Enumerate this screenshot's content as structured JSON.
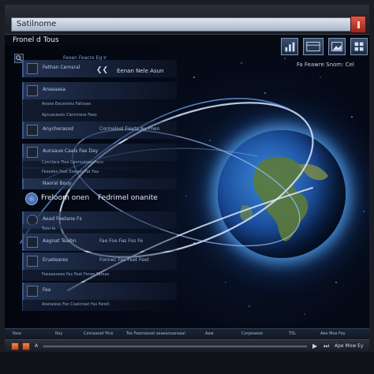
{
  "window": {
    "title_value": "Satilnome",
    "app_title": "Fronel d Tous"
  },
  "header": {
    "nav_link": "Eenan Nele Asun",
    "right_link": "Fa Feawre Snom: Cel"
  },
  "sidebar": {
    "search_text": "Feoen  Feacre  Eg  Ir",
    "items": [
      {
        "label": "Fethan Cernsral",
        "value": ""
      },
      {
        "label": "Anseaasa",
        "value": ""
      },
      {
        "label": "Anese Eecenlets  Fatisses",
        "value": ""
      },
      {
        "label": "Apcsacieels  Clennirere Fees",
        "value": ""
      },
      {
        "label": "Anycherasod",
        "value": "Cormeleel Fieets Au Fhen"
      },
      {
        "label": "Aunsaue Caals  Fae  Day",
        "value": ""
      },
      {
        "label": "Conclace Fiee  Caereatoen  Fens",
        "value": ""
      },
      {
        "label": "Feseden  Feat  Eeeeas  Fat  Fea",
        "value": ""
      },
      {
        "label": "Naoral  Bouy",
        "value": ""
      },
      {
        "label": "Aead  Feetane  Fs",
        "value": ""
      },
      {
        "label": "Tsou Ia",
        "value": ""
      },
      {
        "label": "Aagnat Teaibn",
        "value": "Fae  Foe  Fas  Fos  Fe"
      },
      {
        "label": "Erueleares",
        "value": "Fonnec  Fes  Feet  Feet"
      },
      {
        "label": "Feeseanees  Fas  Feat  Fenes  Fareas",
        "value": ""
      },
      {
        "label": "Faa",
        "value": ""
      },
      {
        "label": "Aoetaleas  Fes  Coatcreat  Fas  Faretl",
        "value": ""
      }
    ],
    "big_row": {
      "label": "Freloom onen",
      "value": "Fedrimel onanite"
    }
  },
  "statusbar": {
    "items": [
      "New",
      "Roy",
      "Comaeoet Fine",
      "Tse  Feamoesel  seaeanoaraaal",
      "Aaw",
      "Corpeaeoe",
      "TSL",
      "Aee  Moe  Fey"
    ]
  },
  "player": {
    "left_label": "A",
    "right_label": "Ape  Mow  Ey"
  },
  "colors": {
    "accent": "#3b5a8c",
    "globe_glow": "#5cb0ff",
    "close_button": "#e05a4a",
    "player_button": "#e98b59"
  }
}
